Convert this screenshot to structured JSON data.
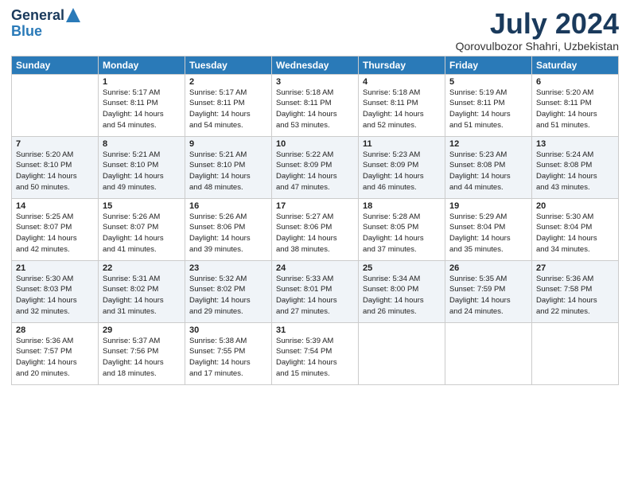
{
  "header": {
    "logo_general": "General",
    "logo_blue": "Blue",
    "title": "July 2024",
    "location": "Qorovulbozor Shahri, Uzbekistan"
  },
  "weekdays": [
    "Sunday",
    "Monday",
    "Tuesday",
    "Wednesday",
    "Thursday",
    "Friday",
    "Saturday"
  ],
  "weeks": [
    [
      {
        "day": "",
        "info": ""
      },
      {
        "day": "1",
        "info": "Sunrise: 5:17 AM\nSunset: 8:11 PM\nDaylight: 14 hours\nand 54 minutes."
      },
      {
        "day": "2",
        "info": "Sunrise: 5:17 AM\nSunset: 8:11 PM\nDaylight: 14 hours\nand 54 minutes."
      },
      {
        "day": "3",
        "info": "Sunrise: 5:18 AM\nSunset: 8:11 PM\nDaylight: 14 hours\nand 53 minutes."
      },
      {
        "day": "4",
        "info": "Sunrise: 5:18 AM\nSunset: 8:11 PM\nDaylight: 14 hours\nand 52 minutes."
      },
      {
        "day": "5",
        "info": "Sunrise: 5:19 AM\nSunset: 8:11 PM\nDaylight: 14 hours\nand 51 minutes."
      },
      {
        "day": "6",
        "info": "Sunrise: 5:20 AM\nSunset: 8:11 PM\nDaylight: 14 hours\nand 51 minutes."
      }
    ],
    [
      {
        "day": "7",
        "info": "Sunrise: 5:20 AM\nSunset: 8:10 PM\nDaylight: 14 hours\nand 50 minutes."
      },
      {
        "day": "8",
        "info": "Sunrise: 5:21 AM\nSunset: 8:10 PM\nDaylight: 14 hours\nand 49 minutes."
      },
      {
        "day": "9",
        "info": "Sunrise: 5:21 AM\nSunset: 8:10 PM\nDaylight: 14 hours\nand 48 minutes."
      },
      {
        "day": "10",
        "info": "Sunrise: 5:22 AM\nSunset: 8:09 PM\nDaylight: 14 hours\nand 47 minutes."
      },
      {
        "day": "11",
        "info": "Sunrise: 5:23 AM\nSunset: 8:09 PM\nDaylight: 14 hours\nand 46 minutes."
      },
      {
        "day": "12",
        "info": "Sunrise: 5:23 AM\nSunset: 8:08 PM\nDaylight: 14 hours\nand 44 minutes."
      },
      {
        "day": "13",
        "info": "Sunrise: 5:24 AM\nSunset: 8:08 PM\nDaylight: 14 hours\nand 43 minutes."
      }
    ],
    [
      {
        "day": "14",
        "info": "Sunrise: 5:25 AM\nSunset: 8:07 PM\nDaylight: 14 hours\nand 42 minutes."
      },
      {
        "day": "15",
        "info": "Sunrise: 5:26 AM\nSunset: 8:07 PM\nDaylight: 14 hours\nand 41 minutes."
      },
      {
        "day": "16",
        "info": "Sunrise: 5:26 AM\nSunset: 8:06 PM\nDaylight: 14 hours\nand 39 minutes."
      },
      {
        "day": "17",
        "info": "Sunrise: 5:27 AM\nSunset: 8:06 PM\nDaylight: 14 hours\nand 38 minutes."
      },
      {
        "day": "18",
        "info": "Sunrise: 5:28 AM\nSunset: 8:05 PM\nDaylight: 14 hours\nand 37 minutes."
      },
      {
        "day": "19",
        "info": "Sunrise: 5:29 AM\nSunset: 8:04 PM\nDaylight: 14 hours\nand 35 minutes."
      },
      {
        "day": "20",
        "info": "Sunrise: 5:30 AM\nSunset: 8:04 PM\nDaylight: 14 hours\nand 34 minutes."
      }
    ],
    [
      {
        "day": "21",
        "info": "Sunrise: 5:30 AM\nSunset: 8:03 PM\nDaylight: 14 hours\nand 32 minutes."
      },
      {
        "day": "22",
        "info": "Sunrise: 5:31 AM\nSunset: 8:02 PM\nDaylight: 14 hours\nand 31 minutes."
      },
      {
        "day": "23",
        "info": "Sunrise: 5:32 AM\nSunset: 8:02 PM\nDaylight: 14 hours\nand 29 minutes."
      },
      {
        "day": "24",
        "info": "Sunrise: 5:33 AM\nSunset: 8:01 PM\nDaylight: 14 hours\nand 27 minutes."
      },
      {
        "day": "25",
        "info": "Sunrise: 5:34 AM\nSunset: 8:00 PM\nDaylight: 14 hours\nand 26 minutes."
      },
      {
        "day": "26",
        "info": "Sunrise: 5:35 AM\nSunset: 7:59 PM\nDaylight: 14 hours\nand 24 minutes."
      },
      {
        "day": "27",
        "info": "Sunrise: 5:36 AM\nSunset: 7:58 PM\nDaylight: 14 hours\nand 22 minutes."
      }
    ],
    [
      {
        "day": "28",
        "info": "Sunrise: 5:36 AM\nSunset: 7:57 PM\nDaylight: 14 hours\nand 20 minutes."
      },
      {
        "day": "29",
        "info": "Sunrise: 5:37 AM\nSunset: 7:56 PM\nDaylight: 14 hours\nand 18 minutes."
      },
      {
        "day": "30",
        "info": "Sunrise: 5:38 AM\nSunset: 7:55 PM\nDaylight: 14 hours\nand 17 minutes."
      },
      {
        "day": "31",
        "info": "Sunrise: 5:39 AM\nSunset: 7:54 PM\nDaylight: 14 hours\nand 15 minutes."
      },
      {
        "day": "",
        "info": ""
      },
      {
        "day": "",
        "info": ""
      },
      {
        "day": "",
        "info": ""
      }
    ]
  ]
}
